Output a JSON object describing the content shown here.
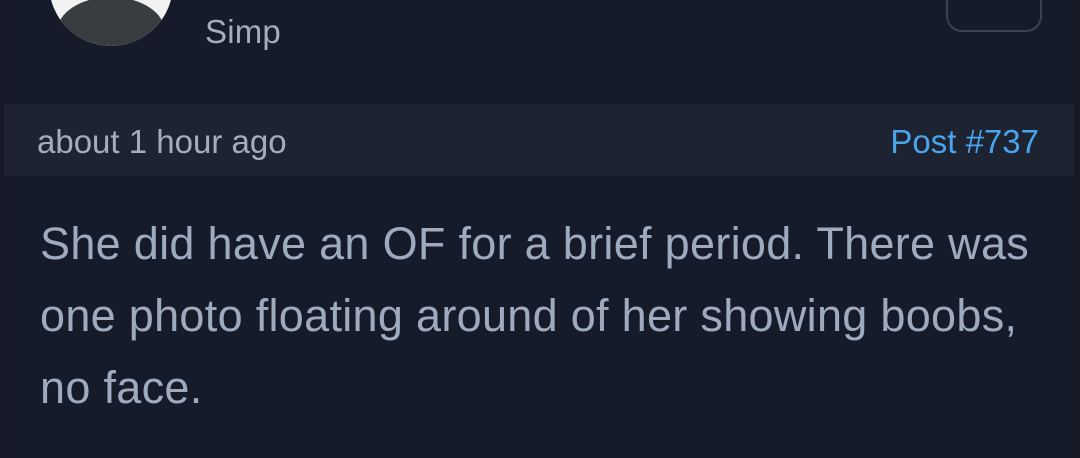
{
  "user": {
    "role": "Simp"
  },
  "post": {
    "time": "about 1 hour ago",
    "number": "Post #737",
    "body": "She did have an OF for a brief period. There was one photo floating around of her showing boobs, no face."
  },
  "colors": {
    "background": "#161b2a",
    "meta_bar": "#1e2331",
    "text": "#9eaabe",
    "link": "#49a4ee"
  },
  "icons": {
    "avatar": "default-user-avatar-icon"
  }
}
